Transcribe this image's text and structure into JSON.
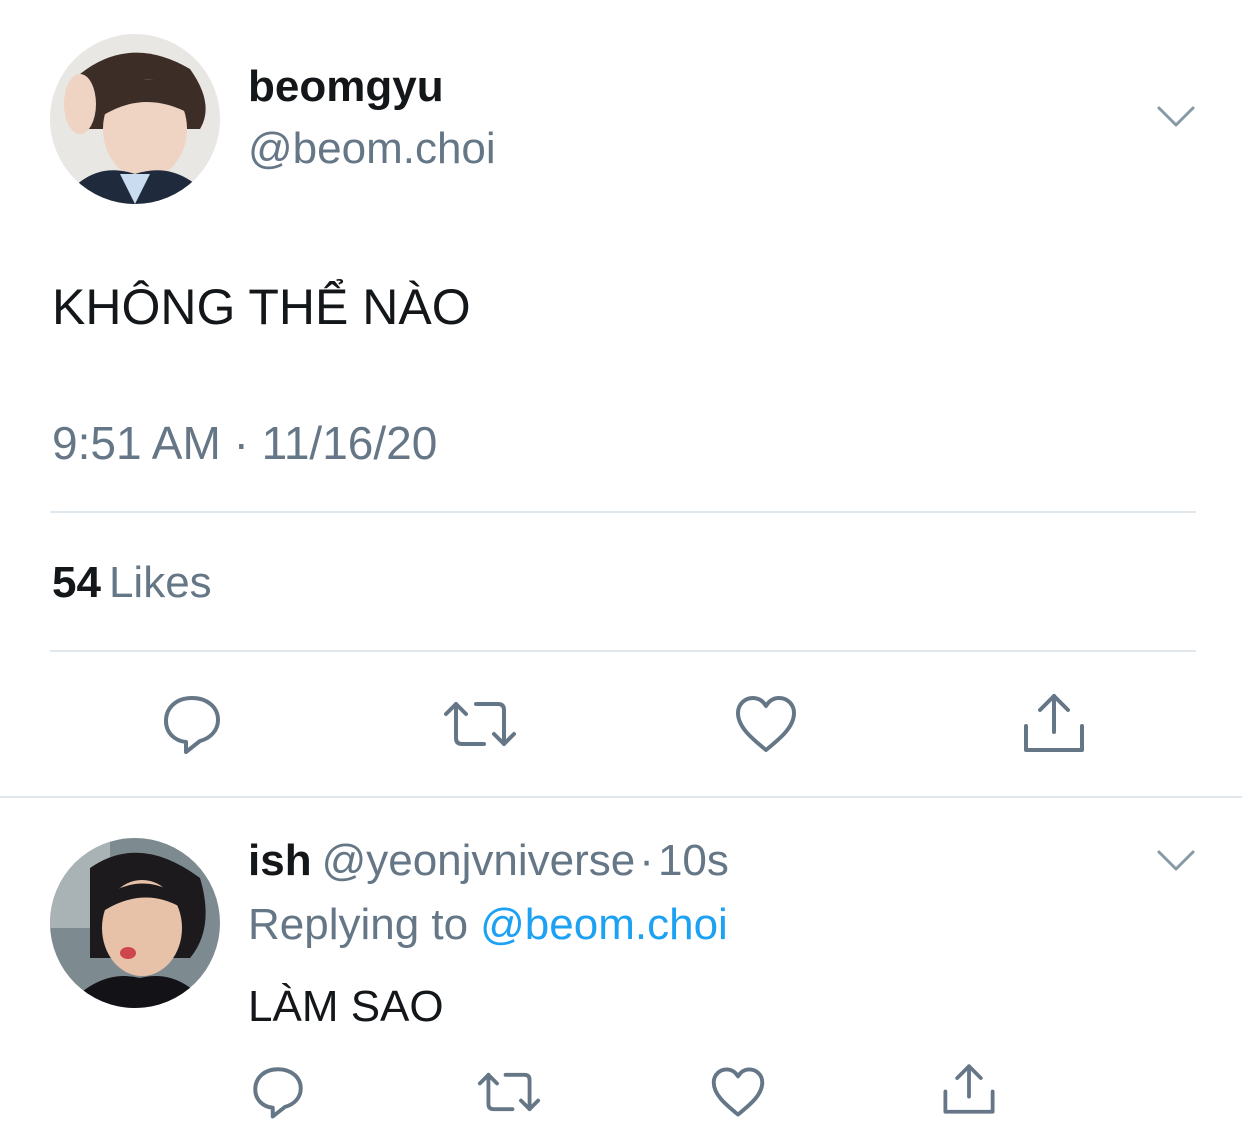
{
  "tweet": {
    "display_name": "beomgyu",
    "handle": "@beom.choi",
    "text": "KHÔNG THỂ NÀO",
    "time": "9:51 AM",
    "separator": "·",
    "date": "11/16/20",
    "likes_count": "54",
    "likes_label": "Likes",
    "icons": [
      "reply-icon",
      "retweet-icon",
      "like-icon",
      "share-icon",
      "chevron-down-icon"
    ]
  },
  "reply": {
    "display_name": "ish",
    "handle": "@yeonjvniverse",
    "separator": "·",
    "time": "10s",
    "replying_label": "Replying to",
    "replying_handle": "@beom.choi",
    "text": "LÀM SAO"
  },
  "colors": {
    "text_primary": "#14171a",
    "text_secondary": "#657786",
    "link": "#1da1f2",
    "divider": "#e1e8ed",
    "icon": "#657786"
  }
}
